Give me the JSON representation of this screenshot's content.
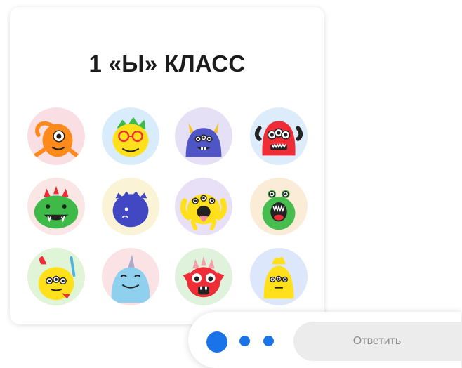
{
  "class_card": {
    "title": "1 «Ы» КЛАСС",
    "avatars": [
      {
        "name": "orange-one-eyed-monster-icon",
        "bg": "#f9dfe4",
        "color": "#ff8a1c"
      },
      {
        "name": "yellow-glasses-monster-icon",
        "bg": "#d8ecfb",
        "color": "#ffe01a"
      },
      {
        "name": "purple-horned-monster-icon",
        "bg": "#e6e0f7",
        "color": "#4f55c4"
      },
      {
        "name": "red-three-eyed-monster-icon",
        "bg": "#dcecfb",
        "color": "#ef2d36"
      },
      {
        "name": "green-spiked-monster-icon",
        "bg": "#fbe6e6",
        "color": "#3fba48"
      },
      {
        "name": "blue-blob-monster-icon",
        "bg": "#fbf3d6",
        "color": "#4248c2"
      },
      {
        "name": "yellow-tongue-monster-icon",
        "bg": "#e8e0f6",
        "color": "#ffe01a"
      },
      {
        "name": "green-screaming-monster-icon",
        "bg": "#fbecd8",
        "color": "#46bd4e"
      },
      {
        "name": "yellow-chick-monster-icon",
        "bg": "#e0f4d8",
        "color": "#ffe01a"
      },
      {
        "name": "lightblue-horn-monster-icon",
        "bg": "#fbe2e4",
        "color": "#8fd0ef"
      },
      {
        "name": "red-spiky-monster-icon",
        "bg": "#dff3dc",
        "color": "#ef2d36"
      },
      {
        "name": "yellow-flame-monster-icon",
        "bg": "#dde7fb",
        "color": "#ffe01a"
      }
    ]
  },
  "reply": {
    "button_label": "Ответить",
    "progress": {
      "current": 1,
      "total": 3
    }
  },
  "colors": {
    "accent": "#1a73e8",
    "title": "#1c1c1c",
    "reply_button_bg": "#ececec"
  }
}
